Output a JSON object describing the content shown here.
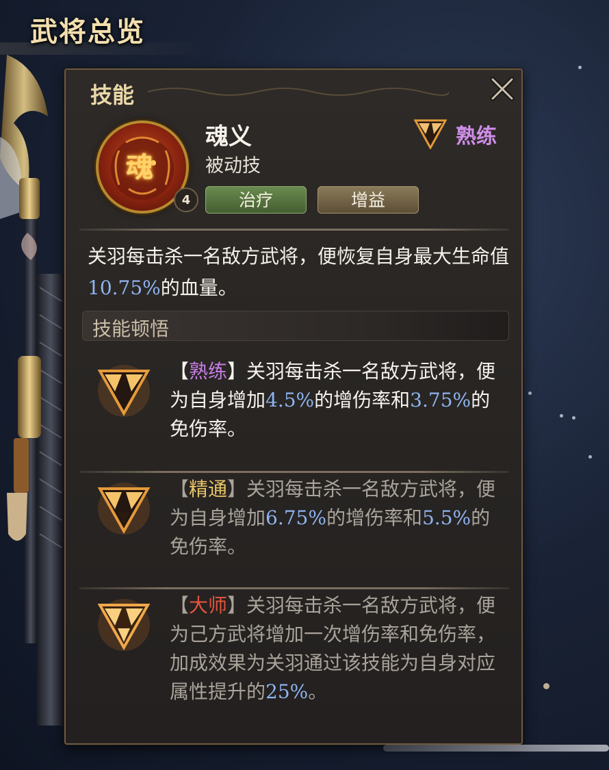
{
  "screen": {
    "title": "武将总览"
  },
  "panel": {
    "title": "技能",
    "close_icon": "close-icon"
  },
  "skill": {
    "name": "魂义",
    "type": "被动技",
    "icon_glyph": "魂",
    "level": "4",
    "mastery_label": "熟练",
    "tags": [
      "治疗",
      "增益"
    ],
    "description": {
      "part1": "关羽每击杀一名敌方武将，便恢复自身最大生命值",
      "value": "10.75%",
      "part2": "的血量。"
    }
  },
  "insight": {
    "header": "技能顿悟",
    "levels": [
      {
        "bracket_open": "【",
        "name": "熟练",
        "bracket_close": "】",
        "text_a": "关羽每击杀一名敌方武将，便为自身增加",
        "value_a": "4.5%",
        "text_b": "的增伤率和",
        "value_b": "3.75%",
        "text_c": "的免伤率。",
        "active": true
      },
      {
        "bracket_open": "【",
        "name": "精通",
        "bracket_close": "】",
        "text_a": "关羽每击杀一名敌方武将，便为自身增加",
        "value_a": "6.75%",
        "text_b": "的增伤率和",
        "value_b": "5.5%",
        "text_c": "的免伤率。",
        "active": false
      },
      {
        "bracket_open": "【",
        "name": "大师",
        "bracket_close": "】",
        "text_a": "关羽每击杀一名敌方武将，便为己方武将增加一次增伤率和免伤率，加成效果为关羽通过该技能为自身对应属性提升的",
        "value_a": "25%",
        "text_b": "。",
        "active": false
      }
    ]
  },
  "colors": {
    "mastery_purple": "#cf8ee8",
    "expert_gold": "#e9c366",
    "master_red": "#e5543e",
    "value_blue": "#8fb4f0"
  }
}
